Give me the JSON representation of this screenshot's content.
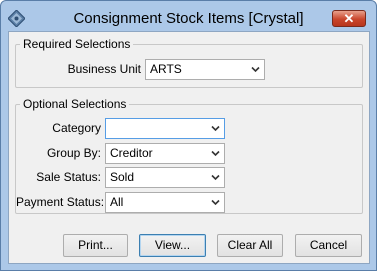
{
  "window": {
    "title": "Consignment Stock Items  [Crystal]",
    "close_glyph": "✕"
  },
  "required": {
    "legend": "Required Selections",
    "business_unit": {
      "label": "Business Unit",
      "value": "ARTS"
    }
  },
  "optional": {
    "legend": "Optional Selections",
    "category": {
      "label": "Category",
      "value": ""
    },
    "group_by": {
      "label": "Group By:",
      "value": "Creditor"
    },
    "sale_status": {
      "label": "Sale Status:",
      "value": "Sold"
    },
    "payment_status": {
      "label": "Payment Status:",
      "value": "All"
    }
  },
  "buttons": {
    "print": "Print...",
    "view": "View...",
    "clear_all": "Clear All",
    "cancel": "Cancel"
  }
}
